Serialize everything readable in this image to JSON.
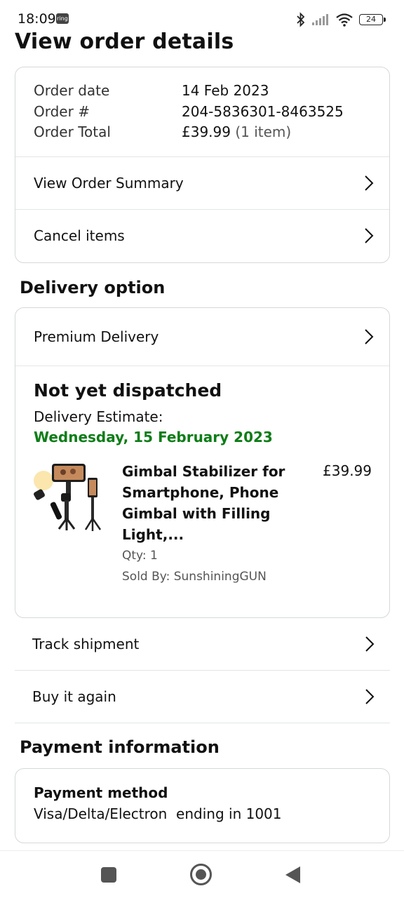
{
  "status_bar": {
    "time": "18:09",
    "notification_badge": "ring",
    "battery": "24",
    "icons": [
      "bluetooth-icon",
      "signal-icon",
      "wifi-icon",
      "battery-icon"
    ]
  },
  "page_title": "View order details",
  "order_summary": {
    "order_date_label": "Order date",
    "order_date_value": "14 Feb 2023",
    "order_number_label": "Order #",
    "order_number_value": "204-5836301-8463525",
    "order_total_label": "Order Total",
    "order_total_value": "£39.99",
    "order_total_items": "(1 item)",
    "view_summary_label": "View Order Summary",
    "cancel_items_label": "Cancel items"
  },
  "delivery": {
    "section_title": "Delivery option",
    "option_label": "Premium Delivery",
    "status": "Not yet dispatched",
    "estimate_label": "Delivery Estimate:",
    "estimate_date": "Wednesday, 15 February 2023",
    "estimate_color": "#0d7d17",
    "product": {
      "title": "Gimbal Stabilizer for Smartphone, Phone Gimbal with Filling Light,...",
      "price": "£39.99",
      "qty": "Qty: 1",
      "seller": "Sold By: SunshiningGUN"
    }
  },
  "actions": {
    "track_shipment": "Track shipment",
    "buy_again": "Buy it again"
  },
  "payment": {
    "section_title": "Payment information",
    "method_label": "Payment method",
    "method_value": "Visa/Delta/Electron  ending in 1001"
  },
  "nav_bar": {
    "buttons": [
      "recents-icon",
      "home-icon",
      "back-icon"
    ]
  }
}
